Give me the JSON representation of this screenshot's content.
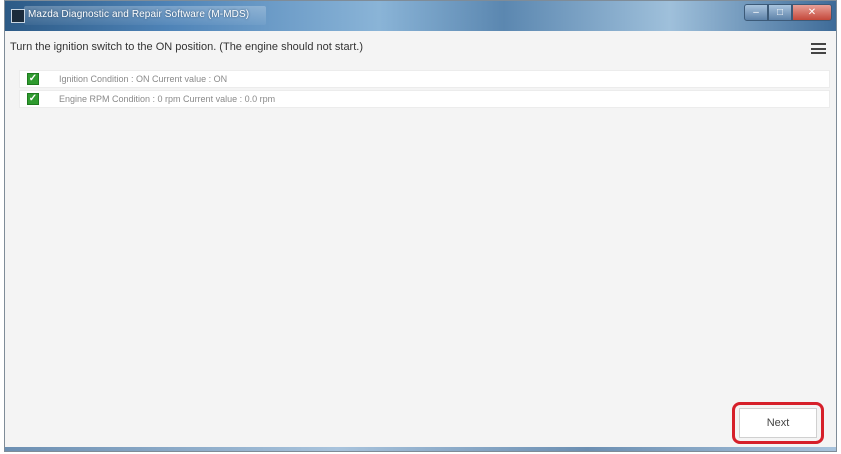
{
  "window": {
    "title": "Mazda Diagnostic and Repair Software (M-MDS)"
  },
  "instruction": "Turn the ignition switch to the ON position.  (The engine should not start.)",
  "conditions": [
    {
      "checked": true,
      "text": "Ignition Condition : ON Current value : ON"
    },
    {
      "checked": true,
      "text": "Engine RPM Condition : 0 rpm Current value : 0.0 rpm"
    }
  ],
  "buttons": {
    "next_label": "Next"
  },
  "icons": {
    "menu": "hamburger-menu-icon",
    "checkbox": "checkmark-icon"
  },
  "colors": {
    "highlight": "#d6202a",
    "checkbox": "#2f9b2f"
  }
}
